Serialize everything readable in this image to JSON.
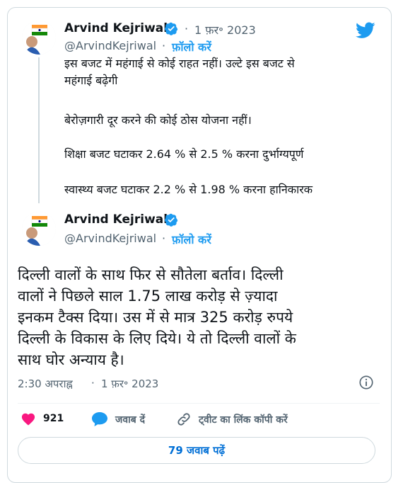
{
  "quoted_tweet": {
    "author_name": "Arvind Kejriwal",
    "handle": "@ArvindKejriwal",
    "separator": "·",
    "date": "1 फ़र॰ 2023",
    "follow_label": "फ़ॉलो करें",
    "lines": [
      "इस बजट में महंगाई से कोई राहत नहीं। उल्टे इस बजट से",
      "महंगाई बढ़ेगी",
      "बेरोज़गारी दूर करने की कोई ठोस योजना नहीं।",
      "शिक्षा बजट घटाकर 2.64 % से 2.5 % करना दुर्भाग्यपूर्ण",
      "स्वास्थ्य बजट घटाकर 2.2 % से 1.98 % करना हानिकारक"
    ]
  },
  "main_tweet": {
    "author_name": "Arvind Kejriwal",
    "handle": "@ArvindKejriwal",
    "separator": "·",
    "follow_label": "फ़ॉलो करें",
    "lines": [
      "दिल्ली वालों के साथ फिर से सौतेला बर्ताव। दिल्ली",
      "वालों ने पिछले साल 1.75 लाख करोड़ से ज़्यादा",
      "इनकम टैक्स दिया। उस में से मात्र 325 करोड़  रुपये",
      "दिल्ली के विकास के लिए दिये। ये तो दिल्ली वालों के",
      "साथ घोर अन्याय है।"
    ],
    "time": "2:30 अपराह्न",
    "date": "1 फ़र॰ 2023"
  },
  "actions": {
    "like_count": "921",
    "reply_label": "जवाब दें",
    "copy_link_label": "ट्वीट का लिंक कॉपी करें"
  },
  "read_replies_label": "79 जवाब पढ़ें",
  "icons": {
    "brand": "twitter-bird-icon",
    "verified": "verified-badge-icon",
    "info": "info-icon",
    "like": "heart-icon",
    "reply": "speech-bubble-icon",
    "copy_link": "link-icon"
  },
  "colors": {
    "twitter_blue": "#1d9bf0",
    "like_red": "#f91880",
    "text": "#0f1419",
    "muted": "#536471"
  }
}
